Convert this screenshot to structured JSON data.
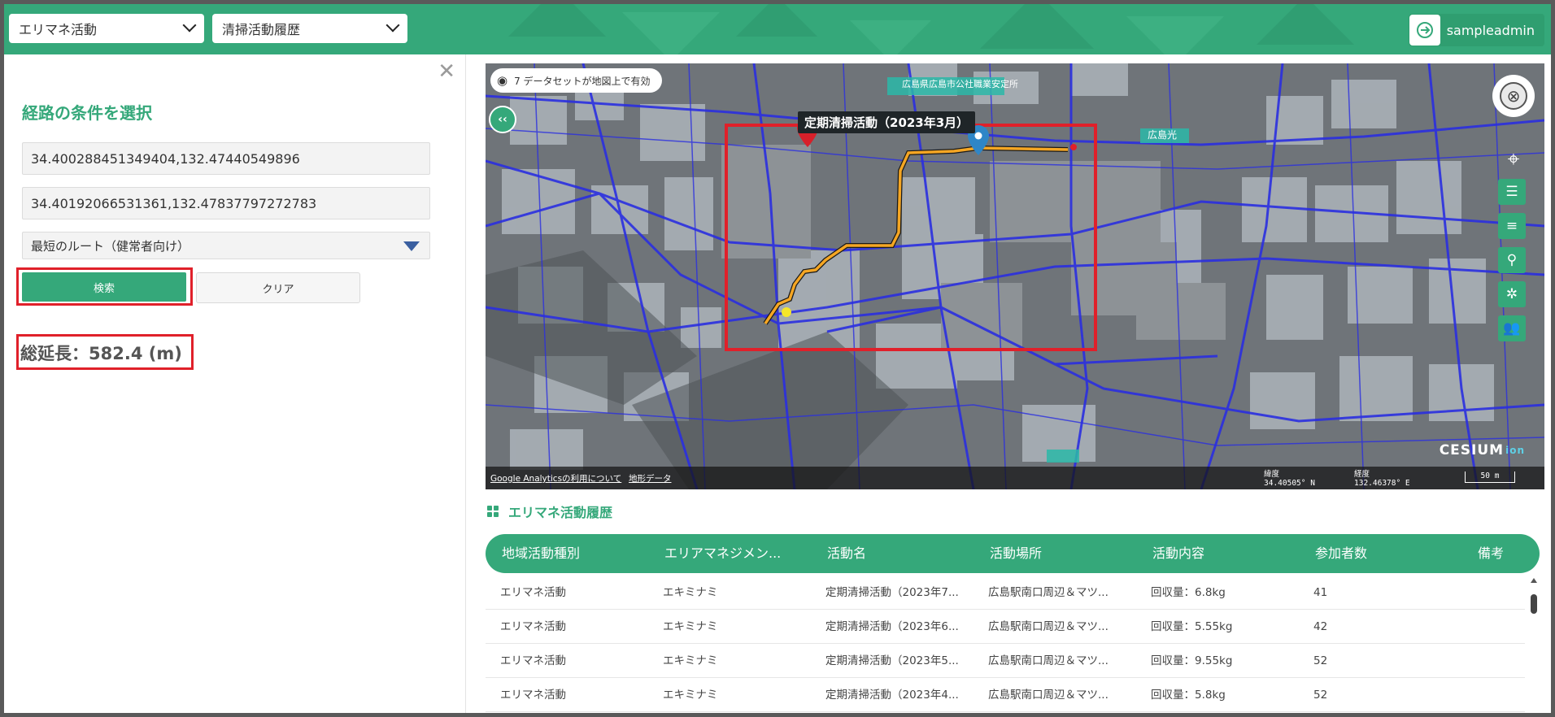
{
  "header": {
    "category_select": "エリマネ活動",
    "dataset_select": "清掃活動履歴",
    "user": "sampleadmin",
    "accent_color": "#35a87a"
  },
  "route_panel": {
    "title": "経路の条件を選択",
    "start_coord": "34.400288451349404,132.47440549896",
    "end_coord": "34.40192066531361,132.47837797272783",
    "route_type": "最短のルート（健常者向け）",
    "search_label": "検索",
    "clear_label": "クリア",
    "total_length": "総延長：582.4 (m)"
  },
  "map": {
    "dataset_status": "7 データセットが地図上で有効",
    "activity_label": "定期清掃活動（2023年3月）",
    "place_label_1": "広島県広島市公社職業安定所",
    "place_label_2": "広島光",
    "footer_link_1": "Google Analyticsの利用について",
    "footer_link_2": "地形データ",
    "lat_label": "緯度",
    "lat_value": "34.40505° N",
    "lon_label": "経度",
    "lon_value": "132.46378° E",
    "scale_label": "50 m",
    "brand": "CESIUM",
    "brand_suffix": "ion",
    "tools": [
      "locate-icon",
      "filter-icon",
      "list-icon",
      "search-icon",
      "network-icon",
      "group-icon"
    ]
  },
  "table": {
    "title": "エリマネ活動履歴",
    "columns": [
      "地域活動種別",
      "エリアマネジメン...",
      "活動名",
      "活動場所",
      "活動内容",
      "参加者数",
      "備考"
    ],
    "rows": [
      [
        "エリマネ活動",
        "エキミナミ",
        "定期清掃活動（2023年7...",
        "広島駅南口周辺＆マツ...",
        "回収量：6.8kg",
        "41",
        ""
      ],
      [
        "エリマネ活動",
        "エキミナミ",
        "定期清掃活動（2023年6...",
        "広島駅南口周辺＆マツ...",
        "回収量：5.55kg",
        "42",
        ""
      ],
      [
        "エリマネ活動",
        "エキミナミ",
        "定期清掃活動（2023年5...",
        "広島駅南口周辺＆マツ...",
        "回収量：9.55kg",
        "52",
        ""
      ],
      [
        "エリマネ活動",
        "エキミナミ",
        "定期清掃活動（2023年4...",
        "広島駅南口周辺＆マツ...",
        "回収量：5.8kg",
        "52",
        ""
      ]
    ]
  }
}
